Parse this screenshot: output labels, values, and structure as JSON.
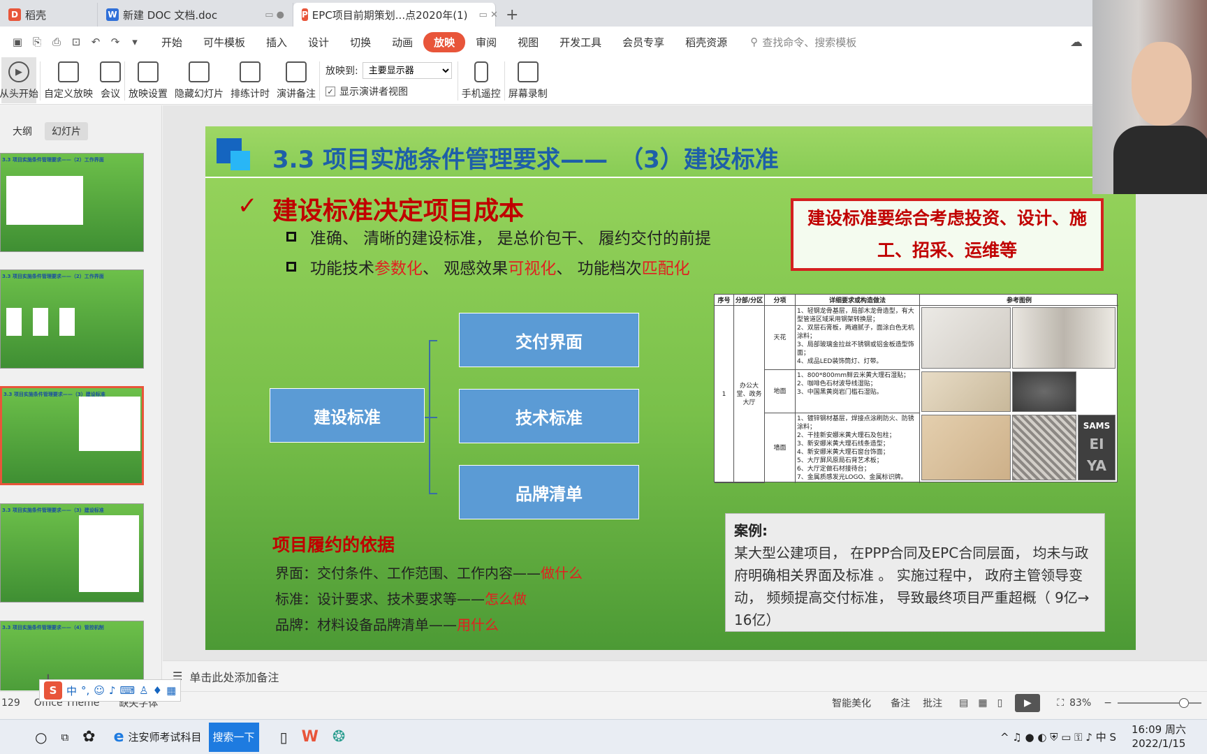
{
  "tabs": [
    {
      "label": "稻壳",
      "icon_color": "#e8553a"
    },
    {
      "label": "新建 DOC 文档.doc",
      "icon_color": "#2f6fd8"
    },
    {
      "label": "EPC项目前期策划...点2020年(1)",
      "icon_color": "#e8553a"
    }
  ],
  "menu": {
    "items": [
      "开始",
      "可牛模板",
      "插入",
      "设计",
      "切换",
      "动画",
      "放映",
      "审阅",
      "视图",
      "开发工具",
      "会员专享",
      "稻壳资源"
    ],
    "active": "放映",
    "search_placeholder": "查找命令、搜索模板"
  },
  "ribbon": {
    "buttons": [
      "从头开始",
      "自定义放映",
      "会议",
      "放映设置",
      "隐藏幻灯片",
      "排练计时",
      "演讲备注"
    ],
    "play_to_label": "放映到:",
    "play_to_value": "主要显示器",
    "presenter_view_label": "显示演讲者视图",
    "presenter_view_checked": true,
    "buttons2": [
      "手机遥控",
      "屏幕录制"
    ]
  },
  "left_panel": {
    "tabs": [
      "大纲",
      "幻灯片"
    ],
    "active_tab": "幻灯片",
    "thumbnails": [
      {
        "title": "3.3 项目实施条件管理要求——（2）工作界面",
        "selected": false
      },
      {
        "title": "3.3 项目实施条件管理要求——（2）工作界面",
        "selected": false
      },
      {
        "title": "3.3 项目实施条件管理要求——（3）建设标准",
        "selected": true
      },
      {
        "title": "3.3 项目实施条件管理要求——（3）建设标准",
        "selected": false
      },
      {
        "title": "3.3 项目实施条件管理要求——（4）管控机制",
        "selected": false
      }
    ]
  },
  "slide": {
    "title": "3.3 项目实施条件管理要求——　（3）建设标准",
    "heading": "建设标准决定项目成本",
    "bullet1": "准确、 清晰的建设标准， 是总价包干、 履约交付的前提",
    "bullet2_a": "功能技术",
    "bullet2_b": "参数化",
    "bullet2_c": "、 观感效果",
    "bullet2_d": "可视化",
    "bullet2_e": "、 功能档次",
    "bullet2_f": "匹配化",
    "diagram": {
      "root": "建设标准",
      "children": [
        "交付界面",
        "技术标准",
        "品牌清单"
      ]
    },
    "callout": "建设标准要综合考虑投资、设计、施工、招采、运维等",
    "basis_title": "项目履约的依据",
    "basis": [
      {
        "label": "界面：交付条件、工作范围、工作内容——",
        "emph": "做什么"
      },
      {
        "label": "标准：设计要求、技术要求等——",
        "emph": "怎么做"
      },
      {
        "label": "品牌：材料设备品牌清单——",
        "emph": "用什么"
      }
    ],
    "case_title": "案例:",
    "case_text": "某大型公建项目， 在PPP合同及EPC合同层面， 均未与政府明确相关界面及标准 。 实施过程中， 政府主管领导变动， 频频提高交付标准， 导致最终项目严重超概（ 9亿→ 16亿）",
    "table": {
      "headers": [
        "序号",
        "分部/分区",
        "分项",
        "详细要求或构造做法",
        "参考图例"
      ],
      "index": "1",
      "area": "办公大堂、政务大厅",
      "rows": [
        {
          "item": "天花",
          "detail": "1、轻钢龙骨基层，局部木龙骨造型，有大型管道区域采用钢架转换层；\n2、双层石膏板，两遍腻子，面涂白色无机涂料；\n3、局部玻璃金拉丝不锈钢或铝金板造型饰面；\n4、成品LED装饰筒灯、灯带。"
        },
        {
          "item": "地面",
          "detail": "1、800*800mm鲜云米黄大理石湿贴；\n2、咖啡色石材波导线湿贴；\n3、中国黑黄岗岩门槛石湿贴。"
        },
        {
          "item": "墙面",
          "detail": "1、镀锌钢材基层，焊接点涂刷防火、防锈涂料；\n2、干挂新安娜米黄大理石及包柱；\n3、新安娜米黄大理石线条造型；\n4、新安娜米黄大理石窗台饰面；\n5、大厅屏风原局石背艺术板；\n6、大厅定做石材接待台；\n7、金属质感发光LOGO、金属标识牌。"
        }
      ],
      "logo_text": [
        "SAMS",
        "EI",
        "YA"
      ]
    }
  },
  "notes_placeholder": "单击此处添加备注",
  "status": {
    "slide_count": "129",
    "theme": "Office Theme",
    "missing_fonts": "缺失字体",
    "smart_beautify": "智能美化",
    "notes": "备注",
    "comments": "批注",
    "zoom": "83%"
  },
  "ime": {
    "mode": "中",
    "punct": "°,"
  },
  "taskbar": {
    "items": [
      "注安师考试科目",
      "搜索一下"
    ],
    "time": "16:09 周六",
    "date": "2022/1/15"
  }
}
